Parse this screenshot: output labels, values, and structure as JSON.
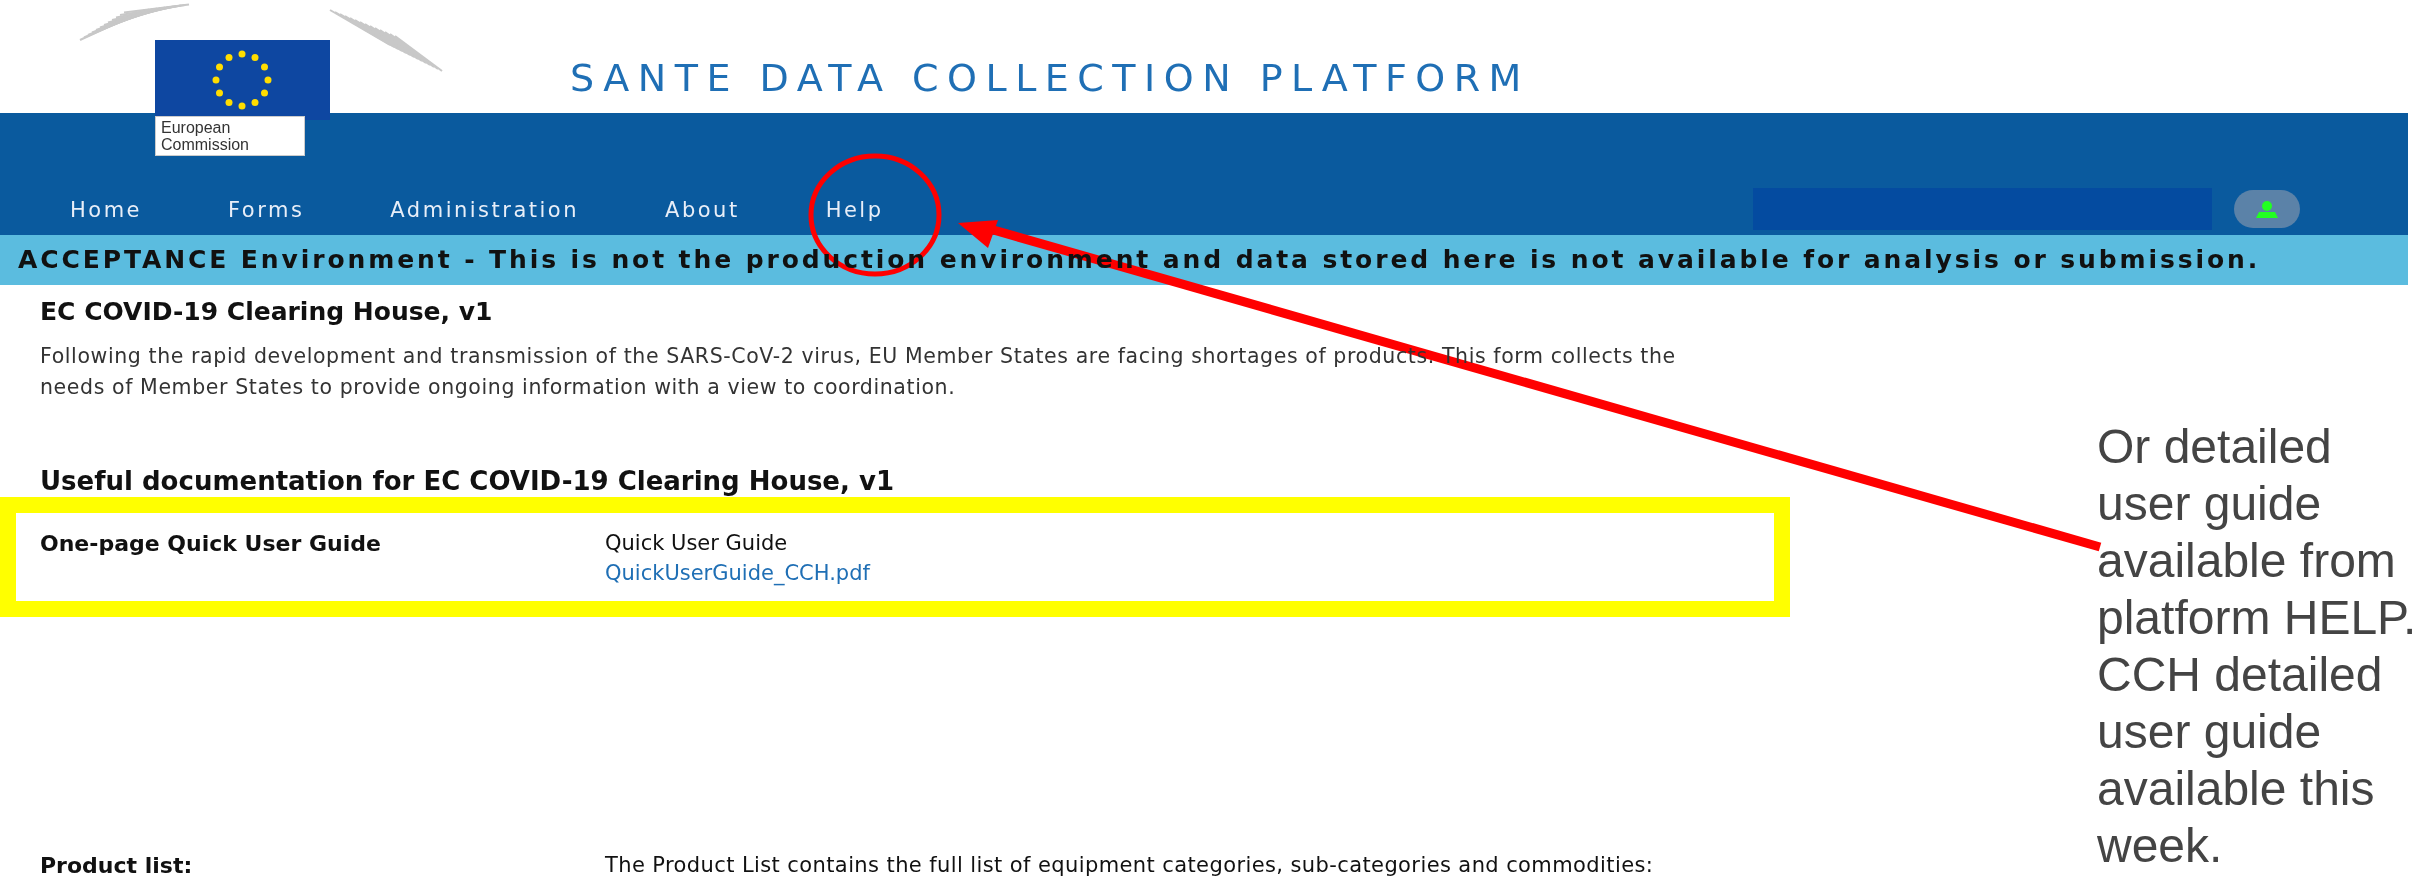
{
  "logo": {
    "caption": "European Commission"
  },
  "title": "SANTE DATA COLLECTION PLATFORM",
  "nav": [
    {
      "label": "Home"
    },
    {
      "label": "Forms"
    },
    {
      "label": "Administration"
    },
    {
      "label": "About"
    },
    {
      "label": "Help"
    }
  ],
  "banner": "ACCEPTANCE Environment - This is not the production environment and data stored here is not available for analysis or submission.",
  "form": {
    "title": "EC COVID-19 Clearing House, v1",
    "description": "Following the rapid development and transmission of the SARS-CoV-2 virus, EU Member States are facing shortages of products. This form collects the needs of Member States to provide ongoing information with a view to coordination."
  },
  "documentation": {
    "heading": "Useful documentation for EC COVID-19 Clearing House, v1",
    "rows": [
      {
        "label": "One-page Quick User Guide",
        "title": "Quick User Guide",
        "link": "QuickUserGuide_CCH.pdf"
      }
    ]
  },
  "product_list": {
    "label": "Product list:",
    "text": "The Product List contains the full list of equipment categories, sub-categories and commodities:"
  },
  "annotation": {
    "note": "Or detailed user guide available from platform HELP. CCH detailed user guide available this week."
  }
}
